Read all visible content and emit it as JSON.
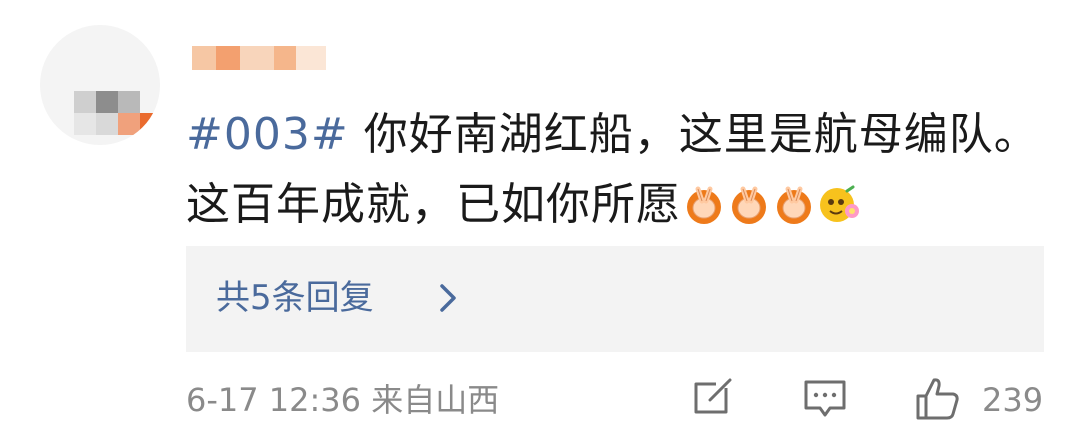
{
  "comment": {
    "hashtag": "#003#",
    "line1_text": " 你好南湖红船，这里是航母编队。",
    "line2_text": "这百年成就，已如你所愿",
    "emojis": [
      "clap-hands-emoji",
      "clap-hands-emoji",
      "clap-hands-emoji",
      "flower-face-emoji"
    ],
    "replies_label": "共5条回复",
    "timestamp_location": "6-17 12:36 来自山西",
    "like_count": "239"
  },
  "colors": {
    "link": "#4a6a9c",
    "text": "#1a1a1a",
    "muted": "#8a8a8a",
    "reply_bg": "#f3f3f3"
  }
}
